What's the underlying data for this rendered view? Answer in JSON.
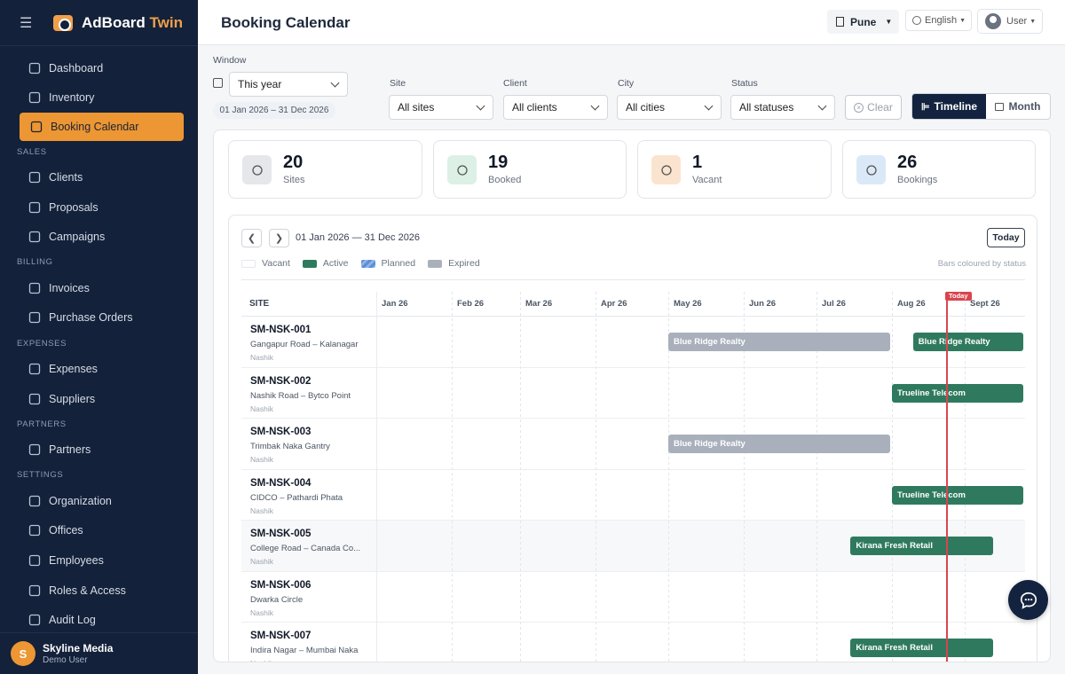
{
  "app": {
    "brand_main": "AdBoard",
    "brand_accent": "Twin"
  },
  "sidebar": {
    "items": [
      {
        "label": "Dashboard",
        "icon": "dashboard-icon"
      },
      {
        "label": "Inventory",
        "icon": "cube-icon"
      },
      {
        "label": "Booking Calendar",
        "icon": "calendar-icon",
        "active": true
      }
    ],
    "sections": [
      {
        "title": "SALES",
        "items": [
          {
            "label": "Clients",
            "icon": "users-icon"
          },
          {
            "label": "Proposals",
            "icon": "document-icon"
          },
          {
            "label": "Campaigns",
            "icon": "megaphone-icon"
          }
        ]
      },
      {
        "title": "BILLING",
        "items": [
          {
            "label": "Invoices",
            "icon": "invoice-icon"
          },
          {
            "label": "Purchase Orders",
            "icon": "clipboard-icon"
          }
        ]
      },
      {
        "title": "EXPENSES",
        "items": [
          {
            "label": "Expenses",
            "icon": "receipt-icon"
          },
          {
            "label": "Suppliers",
            "icon": "truck-icon"
          }
        ]
      },
      {
        "title": "PARTNERS",
        "items": [
          {
            "label": "Partners",
            "icon": "partners-icon"
          }
        ]
      },
      {
        "title": "SETTINGS",
        "items": [
          {
            "label": "Organization",
            "icon": "building-icon"
          },
          {
            "label": "Offices",
            "icon": "office-icon"
          },
          {
            "label": "Employees",
            "icon": "employees-icon"
          },
          {
            "label": "Roles & Access",
            "icon": "shield-icon"
          },
          {
            "label": "Audit Log",
            "icon": "audit-icon"
          }
        ]
      }
    ],
    "user": {
      "initial": "S",
      "name": "Skyline Media",
      "role": "Demo User"
    }
  },
  "header": {
    "title": "Booking Calendar",
    "city": "Pune",
    "language": "English",
    "user": "User"
  },
  "filters": {
    "window_label": "Window",
    "window_value": "This year",
    "range": "01 Jan 2026 – 31 Dec 2026",
    "site_label": "Site",
    "site_value": "All sites",
    "client_label": "Client",
    "client_value": "All clients",
    "city_label": "City",
    "city_value": "All cities",
    "status_label": "Status",
    "status_value": "All statuses",
    "clear": "Clear",
    "view_timeline": "Timeline",
    "view_month": "Month"
  },
  "stats": [
    {
      "value": "20",
      "label": "Sites",
      "color": "#e5e7eb",
      "icon": "grid-icon"
    },
    {
      "value": "19",
      "label": "Booked",
      "color": "#dcf0e6",
      "icon": "check-circle-icon"
    },
    {
      "value": "1",
      "label": "Vacant",
      "color": "#fbe4cf",
      "icon": "circle-icon"
    },
    {
      "value": "26",
      "label": "Bookings",
      "color": "#dbe8f7",
      "icon": "calendar-icon"
    }
  ],
  "calendar": {
    "range": "01 Jan 2026 — 31 Dec 2026",
    "today_btn": "Today",
    "today_tag": "Today",
    "legend": [
      {
        "label": "Vacant",
        "color": "#ffffff"
      },
      {
        "label": "Active",
        "color": "#2f7a5f"
      },
      {
        "label": "Planned",
        "color": "#5b8fd6"
      },
      {
        "label": "Expired",
        "color": "#a9b0bc"
      }
    ],
    "legend_note": "Bars coloured by status",
    "site_header": "SITE",
    "months": [
      "Jan 26",
      "Feb 26",
      "Mar 26",
      "Apr 26",
      "May 26",
      "Jun 26",
      "Jul 26",
      "Aug 26",
      "Sept 26"
    ],
    "rows": [
      {
        "code": "SM-NSK-001",
        "address": "Gangapur Road – Kalanagar",
        "city": "Nashik",
        "bookings": [
          {
            "client": "Blue Ridge Realty",
            "status": "expired",
            "start": "2026-05-01",
            "end": "2026-07-31"
          },
          {
            "client": "Blue Ridge Realty",
            "status": "active",
            "start": "2026-08-10",
            "end": "2026-09-30"
          }
        ]
      },
      {
        "code": "SM-NSK-002",
        "address": "Nashik Road – Bytco Point",
        "city": "Nashik",
        "bookings": [
          {
            "client": "Trueline Telecom",
            "status": "active",
            "start": "2026-08-01",
            "end": "2026-09-30"
          }
        ]
      },
      {
        "code": "SM-NSK-003",
        "address": "Trimbak Naka Gantry",
        "city": "Nashik",
        "bookings": [
          {
            "client": "Blue Ridge Realty",
            "status": "expired",
            "start": "2026-05-01",
            "end": "2026-07-31"
          }
        ]
      },
      {
        "code": "SM-NSK-004",
        "address": "CIDCO – Pathardi Phata",
        "city": "Nashik",
        "bookings": [
          {
            "client": "Trueline Telecom",
            "status": "active",
            "start": "2026-08-01",
            "end": "2026-09-30"
          }
        ]
      },
      {
        "code": "SM-NSK-005",
        "address": "College Road – Canada Co...",
        "city": "Nashik",
        "bookings": [
          {
            "client": "Kirana Fresh Retail",
            "status": "active",
            "start": "2026-07-15",
            "end": "2026-09-15"
          }
        ]
      },
      {
        "code": "SM-NSK-006",
        "address": "Dwarka Circle",
        "city": "Nashik",
        "bookings": []
      },
      {
        "code": "SM-NSK-007",
        "address": "Indira Nagar – Mumbai Naka",
        "city": "Nashik",
        "bookings": [
          {
            "client": "Kirana Fresh Retail",
            "status": "active",
            "start": "2026-07-15",
            "end": "2026-09-15"
          }
        ]
      }
    ]
  }
}
